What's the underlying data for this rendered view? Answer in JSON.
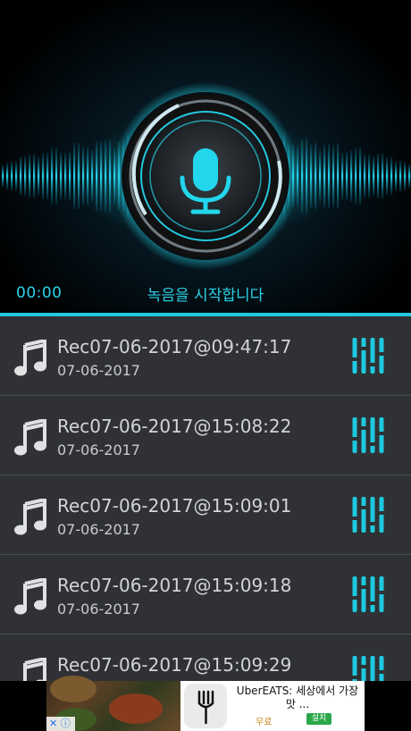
{
  "recorder": {
    "timer": "00:00",
    "status": "녹음을 시작합니다",
    "accent_color": "#20c9df",
    "icon": "microphone-icon"
  },
  "recordings": [
    {
      "name": "Rec07-06-2017@09:47:17",
      "date": "07-06-2017",
      "icon": "music-note-icon",
      "action_icon": "equalizer-icon"
    },
    {
      "name": "Rec07-06-2017@15:08:22",
      "date": "07-06-2017",
      "icon": "music-note-icon",
      "action_icon": "equalizer-icon"
    },
    {
      "name": "Rec07-06-2017@15:09:01",
      "date": "07-06-2017",
      "icon": "music-note-icon",
      "action_icon": "equalizer-icon"
    },
    {
      "name": "Rec07-06-2017@15:09:18",
      "date": "07-06-2017",
      "icon": "music-note-icon",
      "action_icon": "equalizer-icon"
    },
    {
      "name": "Rec07-06-2017@15:09:29",
      "date": "",
      "icon": "music-note-icon",
      "action_icon": "equalizer-icon"
    }
  ],
  "ad": {
    "title": "UberEATS: 세상에서 가장 맛 ...",
    "price": "무료",
    "install": "설치",
    "close_label": "✕",
    "info_label": "ⓘ"
  }
}
